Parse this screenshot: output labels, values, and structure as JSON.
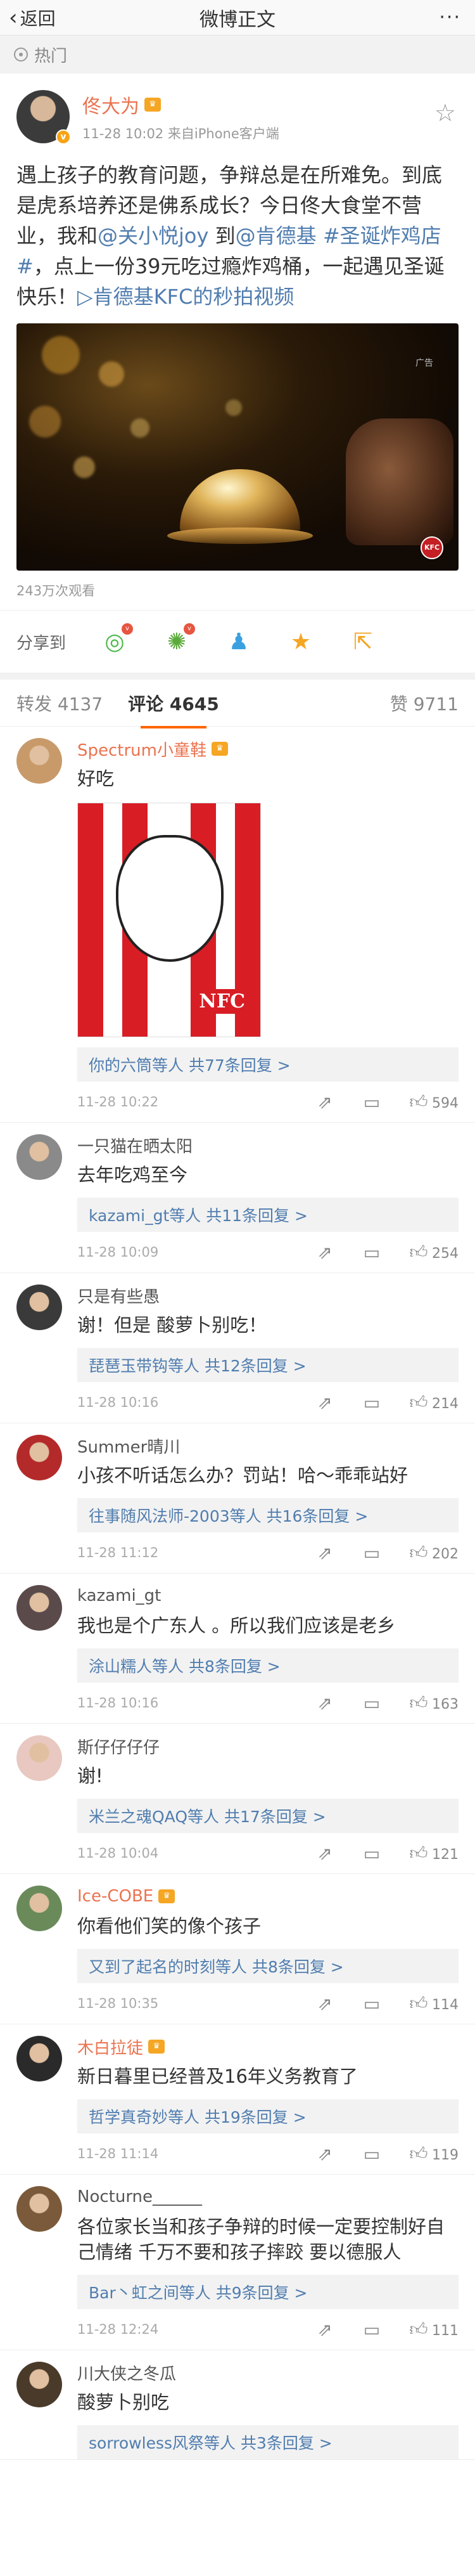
{
  "nav": {
    "back_label": "返回",
    "title": "微博正文",
    "more": "···"
  },
  "hot": {
    "label": "热门"
  },
  "post": {
    "author": "佟大为",
    "meta": "11-28 10:02  来自iPhone客户端",
    "text_segments": [
      {
        "t": "遇上孩子的教育问题，争辩总是在所难免。到底是虎系培养还是佛系成长？今日佟大食堂不营业，我和",
        "link": false
      },
      {
        "t": "@关小悦joy",
        "link": true
      },
      {
        "t": " 到",
        "link": false
      },
      {
        "t": "@肯德基",
        "link": true
      },
      {
        "t": " ",
        "link": false
      },
      {
        "t": "#圣诞炸鸡店#",
        "link": true
      },
      {
        "t": "，点上一份39元吃过瘾炸鸡桶，一起遇见圣诞快乐！",
        "link": false
      },
      {
        "t": "▷肯德基KFC的秒拍视频",
        "link": true
      }
    ],
    "views": "243万次观看"
  },
  "share": {
    "label": "分享到"
  },
  "tabs": {
    "repost": "转发 4137",
    "comment": "评论 4645",
    "likes": "赞 9711"
  },
  "comments": [
    {
      "name": "Spectrum小童鞋",
      "orange": true,
      "text": "好吃",
      "image": true,
      "reply": "你的六筒等人  共77条回复 >",
      "time": "11-28 10:22",
      "likes": "594",
      "avatar": "#c89a6a"
    },
    {
      "name": "一只猫在晒太阳",
      "orange": false,
      "text": "去年吃鸡至今",
      "image": false,
      "reply": "kazami_gt等人  共11条回复 >",
      "time": "11-28 10:09",
      "likes": "254",
      "avatar": "#8a8a8a"
    },
    {
      "name": "只是有些愚",
      "orange": false,
      "text": "谢！但是 酸萝卜别吃！",
      "image": false,
      "reply": "琵琶玉带钩等人  共12条回复 >",
      "time": "11-28 10:16",
      "likes": "214",
      "avatar": "#3a3a3a"
    },
    {
      "name": "Summer晴川",
      "orange": false,
      "text": "小孩不听话怎么办？罚站！哈～乖乖站好",
      "image": false,
      "reply": "往事随风法师-2003等人  共16条回复 >",
      "time": "11-28 11:12",
      "likes": "202",
      "avatar": "#b42a2a"
    },
    {
      "name": "kazami_gt",
      "orange": false,
      "text": "我也是个广东人 。所以我们应该是老乡",
      "image": false,
      "reply": "涂山糯人等人  共8条回复 >",
      "time": "11-28 10:16",
      "likes": "163",
      "avatar": "#5a4a4a"
    },
    {
      "name": "斯仔仔仔仔",
      "orange": false,
      "text": "谢!",
      "image": false,
      "reply": "米兰之魂QAQ等人  共17条回复 >",
      "time": "11-28 10:04",
      "likes": "121",
      "avatar": "#e8c8c0"
    },
    {
      "name": "Ice-COBE",
      "orange": true,
      "text": "你看他们笑的像个孩子",
      "image": false,
      "reply": "又到了起名的时刻等人  共8条回复 >",
      "time": "11-28 10:35",
      "likes": "114",
      "avatar": "#6a8a5a"
    },
    {
      "name": "木白拉徒",
      "orange": true,
      "text": "新日暮里已经普及16年义务教育了",
      "image": false,
      "reply": "哲学真奇妙等人  共19条回复 >",
      "time": "11-28 11:14",
      "likes": "119",
      "avatar": "#2a2a2a"
    },
    {
      "name": "Nocturne______",
      "orange": false,
      "text": "各位家长当和孩子争辩的时候一定要控制好自己情绪 千万不要和孩子摔跤 要以德服人",
      "image": false,
      "reply": "Bar丶虹之间等人  共9条回复 >",
      "time": "11-28 12:24",
      "likes": "111",
      "avatar": "#7a5a3a"
    },
    {
      "name": "川大侠之冬瓜",
      "orange": false,
      "text": "酸萝卜别吃",
      "image": false,
      "reply": "sorrowless风祭等人  共3条回复 >",
      "time": "",
      "likes": "",
      "avatar": "#4a3a2a"
    }
  ]
}
